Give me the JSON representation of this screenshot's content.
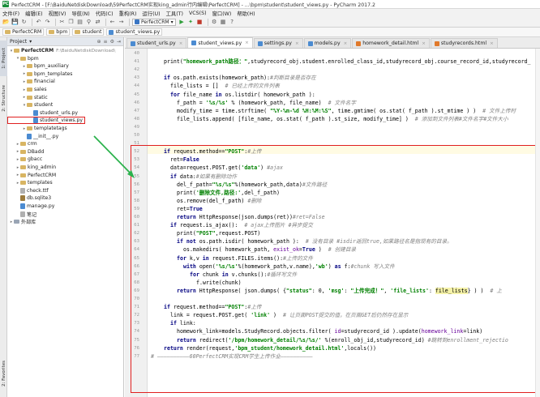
{
  "window": {
    "title": "PerfectCRM - [F:\\BaiduNetdiskDownload\\59PerfectCRM实现king_admin行内编辑\\PerfectCRM] - ...\\bpm\\student\\student_views.py - PyCharm 2017.2"
  },
  "menu": [
    "文件(F)",
    "编辑(E)",
    "视图(V)",
    "导航(N)",
    "代码(C)",
    "重构(R)",
    "运行(U)",
    "工具(T)",
    "VCS(S)",
    "窗口(W)",
    "帮助(H)"
  ],
  "toolbar": {
    "run_config": "PerfectCRM"
  },
  "breadcrumb": [
    "PerfectCRM",
    "bpm",
    "student",
    "student_views.py"
  ],
  "sidebar_tabs": [
    "1: Project",
    "2: Structure",
    "2: Favorites"
  ],
  "project": {
    "header": "Project",
    "items": [
      {
        "label": "PerfectCRM",
        "path": "F:\\BaiduNetdiskDownload\\",
        "type": "folder",
        "depth": 0,
        "open": true
      },
      {
        "label": "bpm",
        "type": "folder",
        "depth": 1,
        "open": true
      },
      {
        "label": "bpm_auxiliary",
        "type": "folder",
        "depth": 2,
        "open": false
      },
      {
        "label": "bpm_templates",
        "type": "folder",
        "depth": 2,
        "open": false
      },
      {
        "label": "financial",
        "type": "folder",
        "depth": 2,
        "open": false
      },
      {
        "label": "sales",
        "type": "folder",
        "depth": 2,
        "open": false
      },
      {
        "label": "static",
        "type": "folder",
        "depth": 2,
        "open": false
      },
      {
        "label": "student",
        "type": "folder",
        "depth": 2,
        "open": true
      },
      {
        "label": "student_urls.py",
        "type": "py",
        "depth": 3
      },
      {
        "label": "student_views.py",
        "type": "py",
        "depth": 3,
        "selected": true
      },
      {
        "label": "templatetags",
        "type": "folder",
        "depth": 2,
        "open": false
      },
      {
        "label": "__init__.py",
        "type": "py",
        "depth": 2
      },
      {
        "label": "crm",
        "type": "folder",
        "depth": 1,
        "open": false
      },
      {
        "label": "DBadd",
        "type": "folder",
        "depth": 1,
        "open": false
      },
      {
        "label": "gbacc",
        "type": "folder",
        "depth": 1,
        "open": false
      },
      {
        "label": "king_admin",
        "type": "folder",
        "depth": 1,
        "open": false
      },
      {
        "label": "PerfectCRM",
        "type": "folder",
        "depth": 1,
        "open": false
      },
      {
        "label": "templates",
        "type": "folder",
        "depth": 1,
        "open": false
      },
      {
        "label": "check.ttf",
        "type": "file",
        "depth": 1
      },
      {
        "label": "db.sqlite3",
        "type": "db",
        "depth": 1
      },
      {
        "label": "manage.py",
        "type": "py",
        "depth": 1
      },
      {
        "label": "笔记",
        "type": "file",
        "depth": 1
      },
      {
        "label": "外部库",
        "type": "lib",
        "depth": 0,
        "open": false
      }
    ]
  },
  "tabs": [
    {
      "label": "student_urls.py",
      "active": false
    },
    {
      "label": "student_views.py",
      "active": true
    },
    {
      "label": "settings.py",
      "active": false
    },
    {
      "label": "models.py",
      "active": false
    },
    {
      "label": "homework_detail.html",
      "active": false
    },
    {
      "label": "studyrecords.html",
      "active": false
    }
  ],
  "editor": {
    "lines": [
      {
        "n": "40",
        "indent": 0,
        "segments": [
          [
            "",
            ""
          ]
        ]
      },
      {
        "n": "41",
        "indent": 4,
        "segments": [
          [
            "fn",
            "print("
          ],
          [
            "st",
            "\"homework_path路径：\""
          ],
          [
            "fn",
            ",studyrecord_obj.student.enrolled_class_id,studyrecord_obj.course_record_id,studyrecord_"
          ]
        ]
      },
      {
        "n": "42",
        "indent": 0,
        "segments": [
          [
            "",
            ""
          ]
        ]
      },
      {
        "n": "43",
        "indent": 4,
        "segments": [
          [
            "kw",
            "if "
          ],
          [
            "fn",
            "os.path.exists(homework_path):"
          ],
          [
            "cm",
            "#判断目录是否存在"
          ]
        ]
      },
      {
        "n": "44",
        "indent": 6,
        "segments": [
          [
            "fn",
            "file_lists = []  "
          ],
          [
            "cm",
            "# 已经上传的文件列表"
          ]
        ]
      },
      {
        "n": "45",
        "indent": 6,
        "segments": [
          [
            "kw",
            "for "
          ],
          [
            "fn",
            "file_name "
          ],
          [
            "kw",
            "in "
          ],
          [
            "fn",
            "os.listdir( homework_path ):"
          ]
        ]
      },
      {
        "n": "46",
        "indent": 8,
        "segments": [
          [
            "fn",
            "f_path = "
          ],
          [
            "st",
            "'%s/%s'"
          ],
          [
            "fn",
            " % (homework_path, file_name)  "
          ],
          [
            "cm",
            "# 文件名字"
          ]
        ]
      },
      {
        "n": "47",
        "indent": 8,
        "segments": [
          [
            "fn",
            "modify_time = time.strftime( "
          ],
          [
            "st",
            "\"%Y-%m-%d %H:%M:%S\""
          ],
          [
            "fn",
            ", time.gmtime( os.stat( f_path ).st_mtime ) )  "
          ],
          [
            "cm",
            "# 文件上传时"
          ]
        ]
      },
      {
        "n": "48",
        "indent": 8,
        "segments": [
          [
            "fn",
            "file_lists.append( [file_name, os.stat( f_path ).st_size, modify_time] )  "
          ],
          [
            "cm",
            "# 添加到文件列表#文件名字#文件大小"
          ]
        ]
      },
      {
        "n": "49",
        "indent": 0,
        "segments": [
          [
            "",
            ""
          ]
        ]
      },
      {
        "n": "50",
        "indent": 0,
        "segments": [
          [
            "",
            ""
          ]
        ]
      },
      {
        "n": "51",
        "indent": 0,
        "segments": [
          [
            "",
            ""
          ]
        ]
      },
      {
        "n": "52",
        "indent": 4,
        "segments": [
          [
            "kw",
            "if "
          ],
          [
            "fn",
            "request.method=="
          ],
          [
            "st",
            "\"POST\""
          ],
          [
            "fn",
            ":"
          ],
          [
            "cm",
            "#上传"
          ]
        ]
      },
      {
        "n": "53",
        "indent": 6,
        "segments": [
          [
            "fn",
            "ret="
          ],
          [
            "kw",
            "False"
          ]
        ]
      },
      {
        "n": "54",
        "indent": 6,
        "segments": [
          [
            "fn",
            "data=request.POST.get("
          ],
          [
            "st",
            "'data'"
          ],
          [
            "fn",
            ") "
          ],
          [
            "cm",
            "#ajax"
          ]
        ]
      },
      {
        "n": "55",
        "indent": 6,
        "segments": [
          [
            "kw",
            "if "
          ],
          [
            "fn",
            "data:"
          ],
          [
            "cm",
            "#如果有删除动作"
          ]
        ]
      },
      {
        "n": "56",
        "indent": 8,
        "segments": [
          [
            "fn",
            "del_f_path="
          ],
          [
            "st",
            "\"%s/%s\""
          ],
          [
            "fn",
            "%(homework_path,data)"
          ],
          [
            "cm",
            "#文件路径"
          ]
        ]
      },
      {
        "n": "57",
        "indent": 8,
        "segments": [
          [
            "fn",
            "print("
          ],
          [
            "st",
            "'删除文件,路径:'"
          ],
          [
            "fn",
            ",del_f_path)"
          ]
        ]
      },
      {
        "n": "58",
        "indent": 8,
        "segments": [
          [
            "fn",
            "os.remove(del_f_path) "
          ],
          [
            "cm",
            "#删除"
          ]
        ]
      },
      {
        "n": "59",
        "indent": 8,
        "segments": [
          [
            "fn",
            "ret="
          ],
          [
            "kw",
            "True"
          ]
        ]
      },
      {
        "n": "60",
        "indent": 8,
        "segments": [
          [
            "kw",
            "return "
          ],
          [
            "fn",
            "HttpResponse(json.dumps(ret))"
          ],
          [
            "cm",
            "#ret=False"
          ]
        ]
      },
      {
        "n": "61",
        "indent": 6,
        "segments": [
          [
            "kw",
            "if "
          ],
          [
            "fn",
            "request.is_ajax():  "
          ],
          [
            "cm",
            "# ajax上传图片 #异步提交"
          ]
        ]
      },
      {
        "n": "62",
        "indent": 8,
        "segments": [
          [
            "fn",
            "print("
          ],
          [
            "st",
            "\"POST\""
          ],
          [
            "fn",
            ",request.POST)"
          ]
        ]
      },
      {
        "n": "63",
        "indent": 8,
        "segments": [
          [
            "kw",
            "if not "
          ],
          [
            "fn",
            "os.path.isdir( homework_path ):  "
          ],
          [
            "cm",
            "# 没有目录 #isdir返回true,如果路径名是指现有的目录。"
          ]
        ]
      },
      {
        "n": "64",
        "indent": 10,
        "segments": [
          [
            "fn",
            "os.makedirs( homework_path, "
          ],
          [
            "pn",
            "exist_ok"
          ],
          [
            "fn",
            "="
          ],
          [
            "kw",
            "True"
          ],
          [
            "fn",
            " )  "
          ],
          [
            "cm",
            "# 创建目录"
          ]
        ]
      },
      {
        "n": "65",
        "indent": 8,
        "segments": [
          [
            "kw",
            "for "
          ],
          [
            "fn",
            "k,v "
          ],
          [
            "kw",
            "in "
          ],
          [
            "fn",
            "request.FILES.items():"
          ],
          [
            "cm",
            "#上传的文件"
          ]
        ]
      },
      {
        "n": "66",
        "indent": 10,
        "segments": [
          [
            "kw",
            "with "
          ],
          [
            "fn",
            "open("
          ],
          [
            "st",
            "'%s/%s'"
          ],
          [
            "fn",
            "%(homework_path,v.name),"
          ],
          [
            "st",
            "'wb'"
          ],
          [
            "fn",
            ") "
          ],
          [
            "kw",
            "as "
          ],
          [
            "fn",
            "f:"
          ],
          [
            "cm",
            "#chunk 写入文件"
          ]
        ]
      },
      {
        "n": "67",
        "indent": 12,
        "segments": [
          [
            "kw",
            "for "
          ],
          [
            "fn",
            "chunk "
          ],
          [
            "kw",
            "in "
          ],
          [
            "fn",
            "v.chunks():"
          ],
          [
            "cm",
            "#循环写文件"
          ]
        ]
      },
      {
        "n": "68",
        "indent": 14,
        "segments": [
          [
            "fn",
            "f.write(chunk)"
          ]
        ]
      },
      {
        "n": "69",
        "indent": 8,
        "segments": [
          [
            "kw",
            "return "
          ],
          [
            "fn",
            "HttpResponse( json.dumps( {"
          ],
          [
            "st",
            "\"status\""
          ],
          [
            "fn",
            ": 0, "
          ],
          [
            "st",
            "'msg'"
          ],
          [
            "fn",
            ": "
          ],
          [
            "st",
            "\"上传完成！\""
          ],
          [
            "fn",
            ", "
          ],
          [
            "st",
            "'file_lists'"
          ],
          [
            "fn",
            ": "
          ],
          [
            "hl",
            "file_lists"
          ],
          [
            "fn",
            "} ) )  "
          ],
          [
            "cm",
            "# 上"
          ]
        ]
      },
      {
        "n": "70",
        "indent": 0,
        "segments": [
          [
            "",
            ""
          ]
        ]
      },
      {
        "n": "71",
        "indent": 4,
        "segments": [
          [
            "kw",
            "if "
          ],
          [
            "fn",
            "request.method=="
          ],
          [
            "st",
            "\"POST\""
          ],
          [
            "fn",
            ":"
          ],
          [
            "cm",
            "#上传"
          ]
        ]
      },
      {
        "n": "72",
        "indent": 6,
        "segments": [
          [
            "fn",
            "link = request.POST.get( "
          ],
          [
            "st",
            "'link'"
          ],
          [
            "fn",
            " )  "
          ],
          [
            "cm",
            "# 让页面POST提交的值，在页面GET后仍然存在显示"
          ]
        ]
      },
      {
        "n": "73",
        "indent": 6,
        "segments": [
          [
            "kw",
            "if "
          ],
          [
            "fn",
            "link:"
          ]
        ]
      },
      {
        "n": "74",
        "indent": 8,
        "segments": [
          [
            "fn",
            "homework_link=models.StudyRecord.objects.filter( "
          ],
          [
            "pn",
            "id"
          ],
          [
            "fn",
            "=studyrecord_id ).update("
          ],
          [
            "pn",
            "homework_link"
          ],
          [
            "fn",
            "=link)"
          ]
        ]
      },
      {
        "n": "75",
        "indent": 8,
        "segments": [
          [
            "kw",
            "return "
          ],
          [
            "fn",
            "redirect("
          ],
          [
            "st",
            "'/bpm/homework_detail/%s/%s/'"
          ],
          [
            "fn",
            " %(enroll_obj_id,studyrecord_id) "
          ],
          [
            "cm",
            "#跳转到enrollment_rejectio"
          ]
        ]
      },
      {
        "n": "76",
        "indent": 4,
        "segments": [
          [
            "kw",
            "return "
          ],
          [
            "fn",
            "render(request,"
          ],
          [
            "st",
            "'bpm_student/homework_detail.html'"
          ],
          [
            "fn",
            ",locals())"
          ]
        ]
      },
      {
        "n": "77",
        "indent": 0,
        "segments": [
          [
            "cm",
            "# ——————————60PerfectCRM实现CRM学生上传作业——————————"
          ]
        ]
      }
    ]
  }
}
